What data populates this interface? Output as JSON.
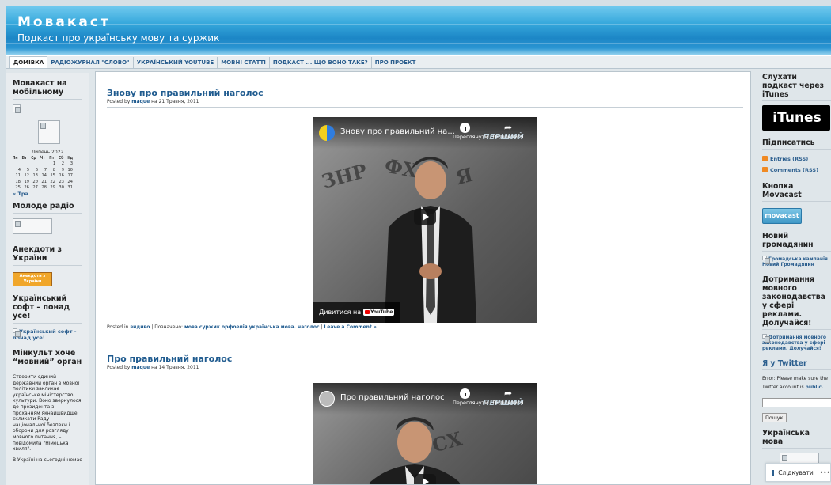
{
  "header": {
    "title": "Мовакаст",
    "description": "Подкаст про українську мову та суржик"
  },
  "nav": [
    "ДОМІВКА",
    "РАДІОЖУРНАЛ \"СЛОВО\"",
    "УКРАЇНСЬКИЙ YOUTUBE",
    "МОВНІ СТАТТІ",
    "ПОДКАСТ ... ЩО ВОНО ТАКЕ?",
    "ПРО ПРОЕКТ"
  ],
  "left": {
    "mobile_heading": "Мовакаст на мобільному",
    "calendar": {
      "caption": "Липень 2022",
      "head": [
        "Пн",
        "Вт",
        "Ср",
        "Чт",
        "Пт",
        "Сб",
        "Нд"
      ],
      "rows": [
        [
          "",
          "",
          "",
          "",
          "1",
          "2",
          "3"
        ],
        [
          "4",
          "5",
          "6",
          "7",
          "8",
          "9",
          "10"
        ],
        [
          "11",
          "12",
          "13",
          "14",
          "15",
          "16",
          "17"
        ],
        [
          "18",
          "19",
          "20",
          "21",
          "22",
          "23",
          "24"
        ],
        [
          "25",
          "26",
          "27",
          "28",
          "29",
          "30",
          "31"
        ]
      ],
      "prev": "« Тра"
    },
    "radio_heading": "Молоде радіо",
    "jokes_heading": "Анекдоти з України",
    "jokes_badge": "Анекдоти з України",
    "soft_heading": "Український софт – понад усе!",
    "soft_link": "Український софт - понад усе!",
    "mincult_heading": "Мінкульт хоче “мовний” орган",
    "mincult_text": "Створити єдиний державний орган з мовної політики закликає українське міністерство культури. Воно звернулося до президента з проханням якнайшвидше скликати Раду національної безпеки і оборони для розгляду мовного питання, – повідомила \"Німецька хвиля\".",
    "mincult_text2": "В Україні на сьогодні немає"
  },
  "posts": [
    {
      "title": "Знову про правильний наголос",
      "posted_by": "Posted by",
      "author": "maque",
      "date": "на 21 Травня, 2011",
      "video_title": "Знову про правильний на...",
      "watch_label": "Переглянути...",
      "share_label": "Поділитися",
      "watch_on": "Дивитися на",
      "youtube": "YouTube",
      "channel_logo": "ПЕРШИЙ",
      "category_prefix": "Posted in",
      "category": "видиво",
      "tags_prefix": "| Позначено:",
      "tags": "мова суржик орфоепія українська мова. наголос",
      "comment": "Leave a Comment »"
    },
    {
      "title": "Про правильний наголос",
      "posted_by": "Posted by",
      "author": "maque",
      "date": "на 14 Травня, 2011",
      "video_title": "Про правильний наголос",
      "watch_label": "Переглянути...",
      "share_label": "Поділитися",
      "channel_logo": "ПЕРШИЙ"
    }
  ],
  "right": {
    "itunes_heading": "Слухати подкаст через iTunes",
    "itunes_badge": "iTunes",
    "subscribe_heading": "Підписатись",
    "rss_entries": "Entries (RSS)",
    "rss_comments": "Comments (RSS)",
    "button_heading": "Кнопка Movacast",
    "button_label": "movacast",
    "citizen_heading": "Новий громадянин",
    "citizen_link": "Громадська кампанія Новий Громадянин",
    "law_heading": "Дотримання мовного законодавства у сфері реклами. Долучайся!",
    "law_link": "Дотримання мовного законодавства у сфері реклами. Долучайся!",
    "twitter_heading": "Я у Twitter",
    "twitter_error": "Error: Please make sure the Twitter account is",
    "twitter_public": "public.",
    "search_button": "Пошук",
    "lang_heading": "Українська мова"
  },
  "follow": {
    "label": "Слідкувати",
    "dots": "•••"
  },
  "colors": {
    "link": "#1f5b8f",
    "header": "#1c86c6",
    "sidebar": "#e8ecef"
  }
}
